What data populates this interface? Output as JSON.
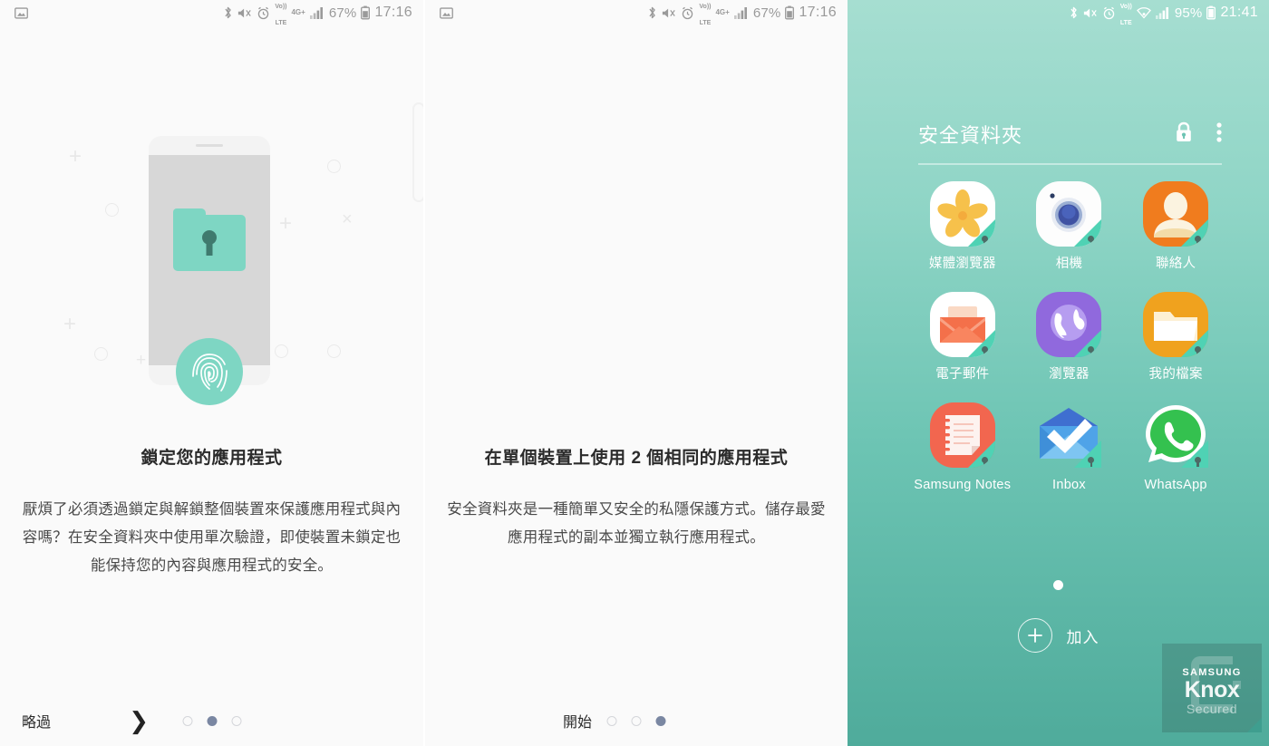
{
  "panels": [
    {
      "id": "intro-lock-apps",
      "statusbar": {
        "left_icon": "screenshot-icon",
        "icons": [
          "bluetooth-icon",
          "mute-icon",
          "alarm-icon",
          "volte-icon",
          "4g-plus-icon",
          "signal-icon"
        ],
        "volte_top": "Vo))",
        "volte_bottom": "LTE",
        "network": "4G+",
        "battery": "67%",
        "time": "17:16"
      },
      "title": "鎖定您的應用程式",
      "body": "厭煩了必須透過鎖定與解鎖整個裝置來保護應用程式與內容嗎？在安全資料夾中使用單次驗證，即使裝置未鎖定也能保持您的內容與應用程式的安全。",
      "skip_label": "略過",
      "next_icon": "chevron-right-icon",
      "dots_total": 3,
      "dots_active": 2
    },
    {
      "id": "intro-two-apps",
      "statusbar": {
        "left_icon": "screenshot-icon",
        "icons": [
          "bluetooth-icon",
          "mute-icon",
          "alarm-icon",
          "volte-icon",
          "4g-plus-icon",
          "signal-icon"
        ],
        "volte_top": "Vo))",
        "volte_bottom": "LTE",
        "network": "4G+",
        "battery": "67%",
        "time": "17:16"
      },
      "title": "在單個裝置上使用 2 個相同的應用程式",
      "body": "安全資料夾是一種簡單又安全的私隱保護方式。儲存最愛應用程式的副本並獨立執行應用程式。",
      "start_label": "開始",
      "dots_total": 3,
      "dots_active": 3
    },
    {
      "id": "secure-folder-home",
      "statusbar": {
        "icons": [
          "bluetooth-icon",
          "mute-icon",
          "alarm-icon",
          "volte-icon",
          "wifi-icon",
          "signal-icon"
        ],
        "volte_top": "Vo))",
        "volte_bottom": "LTE",
        "battery": "95%",
        "time": "21:41"
      },
      "header": {
        "title": "安全資料夾",
        "lock_icon": "lock-icon",
        "menu_icon": "more-vertical-icon"
      },
      "apps": [
        {
          "label": "媒體瀏覽器",
          "icon": "gallery-icon"
        },
        {
          "label": "相機",
          "icon": "camera-icon"
        },
        {
          "label": "聯絡人",
          "icon": "contacts-icon"
        },
        {
          "label": "電子郵件",
          "icon": "email-icon"
        },
        {
          "label": "瀏覽器",
          "icon": "browser-icon"
        },
        {
          "label": "我的檔案",
          "icon": "my-files-icon"
        },
        {
          "label": "Samsung Notes",
          "icon": "samsung-notes-icon"
        },
        {
          "label": "Inbox",
          "icon": "inbox-icon"
        },
        {
          "label": "WhatsApp",
          "icon": "whatsapp-icon"
        }
      ],
      "page_dots_total": 1,
      "page_dots_active": 1,
      "add_label": "加入",
      "add_icon": "plus-circle-icon",
      "watermark": {
        "brand": "SAMSUNG",
        "product": "Knox",
        "state": "Secured"
      }
    }
  ],
  "colors": {
    "panel_bg": "#fafafa",
    "teal_accent": "#7ed6c3",
    "teal_dark": "#4fab9b",
    "teal_light": "#a6ded1",
    "dot_active": "#7a87a2",
    "title_text": "#2b2b2b",
    "body_text": "#4a4a4a",
    "badge_teal": "#4fd2b4",
    "orange": "#f5a03c",
    "lock_keyhole": "#3f7a6e"
  }
}
